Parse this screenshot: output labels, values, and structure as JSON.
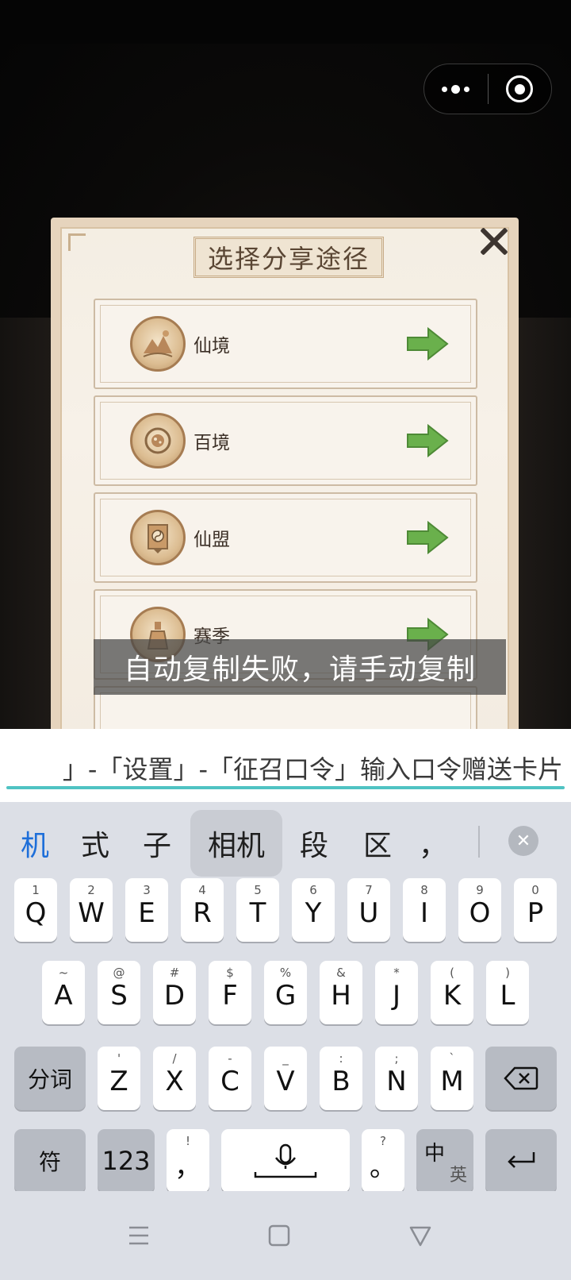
{
  "capsule": {
    "more_icon": "more-dots-icon",
    "close_icon": "target-close-icon"
  },
  "dialog": {
    "title": "选择分享途径",
    "options": [
      {
        "label": "仙境",
        "icon": "mountain-emblem-icon"
      },
      {
        "label": "百境",
        "icon": "orb-emblem-icon"
      },
      {
        "label": "仙盟",
        "icon": "banner-emblem-icon"
      },
      {
        "label": "赛季",
        "icon": "statue-emblem-icon"
      }
    ]
  },
  "toast": "自动复制失败，请手动复制",
  "input": {
    "value": "」-「设置」-「征召口令」输入口令赠送卡片"
  },
  "keyboard": {
    "candidates": [
      "机",
      "式",
      "子",
      "相机",
      "段",
      "区",
      "，"
    ],
    "row1": [
      {
        "k": "Q",
        "s": "1"
      },
      {
        "k": "W",
        "s": "2"
      },
      {
        "k": "E",
        "s": "3"
      },
      {
        "k": "R",
        "s": "4"
      },
      {
        "k": "T",
        "s": "5"
      },
      {
        "k": "Y",
        "s": "6"
      },
      {
        "k": "U",
        "s": "7"
      },
      {
        "k": "I",
        "s": "8"
      },
      {
        "k": "O",
        "s": "9"
      },
      {
        "k": "P",
        "s": "0"
      }
    ],
    "row2": [
      {
        "k": "A",
        "s": "~"
      },
      {
        "k": "S",
        "s": "@"
      },
      {
        "k": "D",
        "s": "#"
      },
      {
        "k": "F",
        "s": "$"
      },
      {
        "k": "G",
        "s": "%"
      },
      {
        "k": "H",
        "s": "&"
      },
      {
        "k": "J",
        "s": "*"
      },
      {
        "k": "K",
        "s": "("
      },
      {
        "k": "L",
        "s": ")"
      }
    ],
    "row3": [
      {
        "k": "Z",
        "s": "'"
      },
      {
        "k": "X",
        "s": "/"
      },
      {
        "k": "C",
        "s": "-"
      },
      {
        "k": "V",
        "s": "_"
      },
      {
        "k": "B",
        "s": ":"
      },
      {
        "k": "N",
        "s": ";"
      },
      {
        "k": "M",
        "s": "`"
      }
    ],
    "fenci": "分词",
    "fu": "符",
    "num": "123",
    "comma": "，",
    "comma_sup": "!",
    "period": "。",
    "period_sup": "?",
    "lang_main": "中",
    "lang_sub": "英"
  },
  "colors": {
    "accent": "#1e6fd9",
    "input_line": "#4fc3c3",
    "arrow_green": "#6ab04c"
  }
}
